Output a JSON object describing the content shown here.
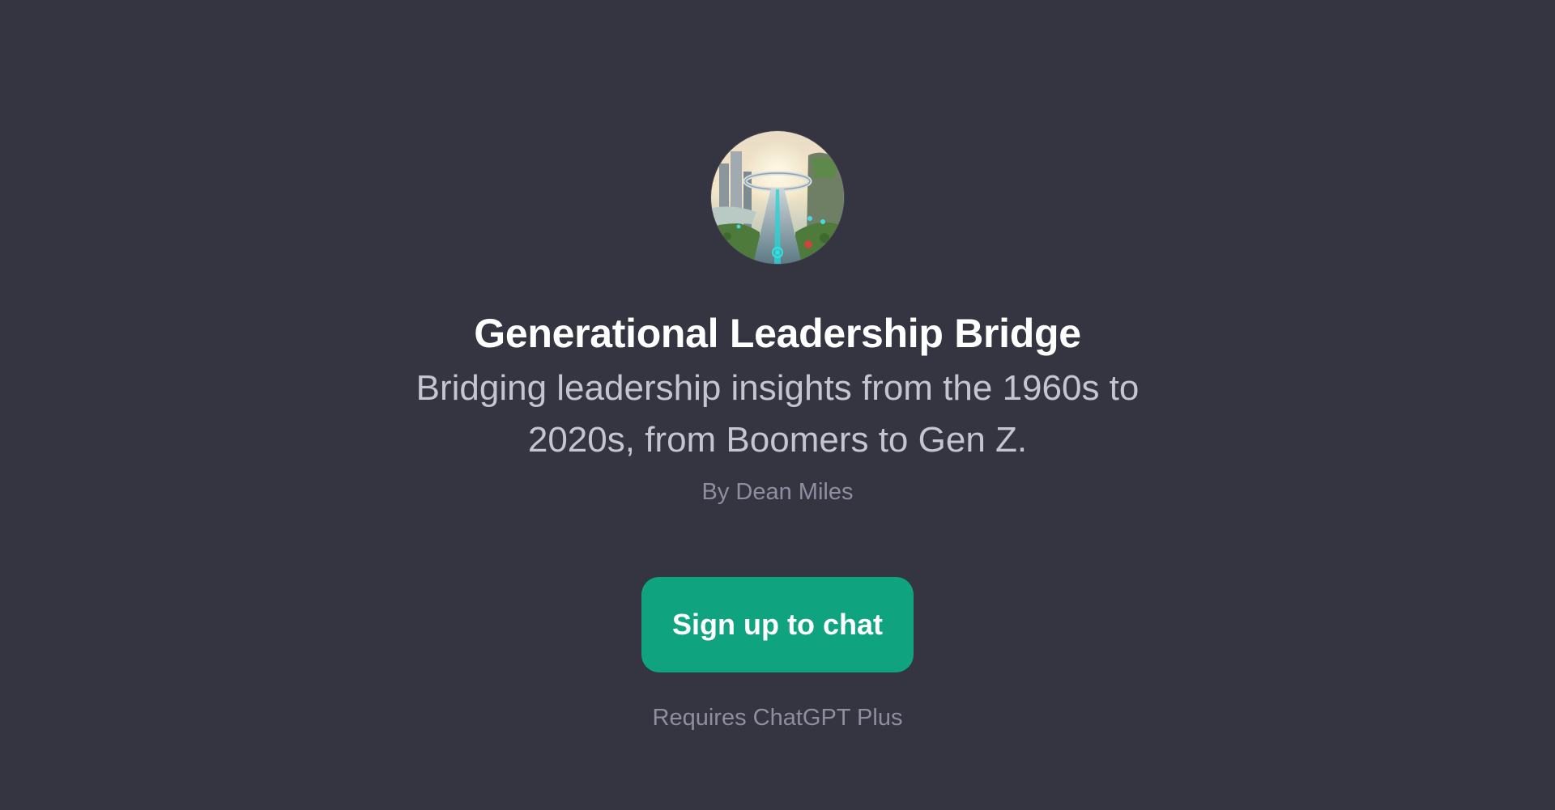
{
  "gpt": {
    "title": "Generational Leadership Bridge",
    "description": "Bridging leadership insights from the 1960s to 2020s, from Boomers to Gen Z.",
    "author": "By Dean Miles"
  },
  "actions": {
    "signup_label": "Sign up to chat"
  },
  "footer": {
    "requirement": "Requires ChatGPT Plus"
  },
  "colors": {
    "background": "#343541",
    "accent": "#10a37f",
    "title": "#ffffff",
    "description": "#c5c5d2",
    "muted": "#8e8ea0"
  },
  "icons": {
    "avatar": "futuristic-bridge-city-avatar"
  }
}
